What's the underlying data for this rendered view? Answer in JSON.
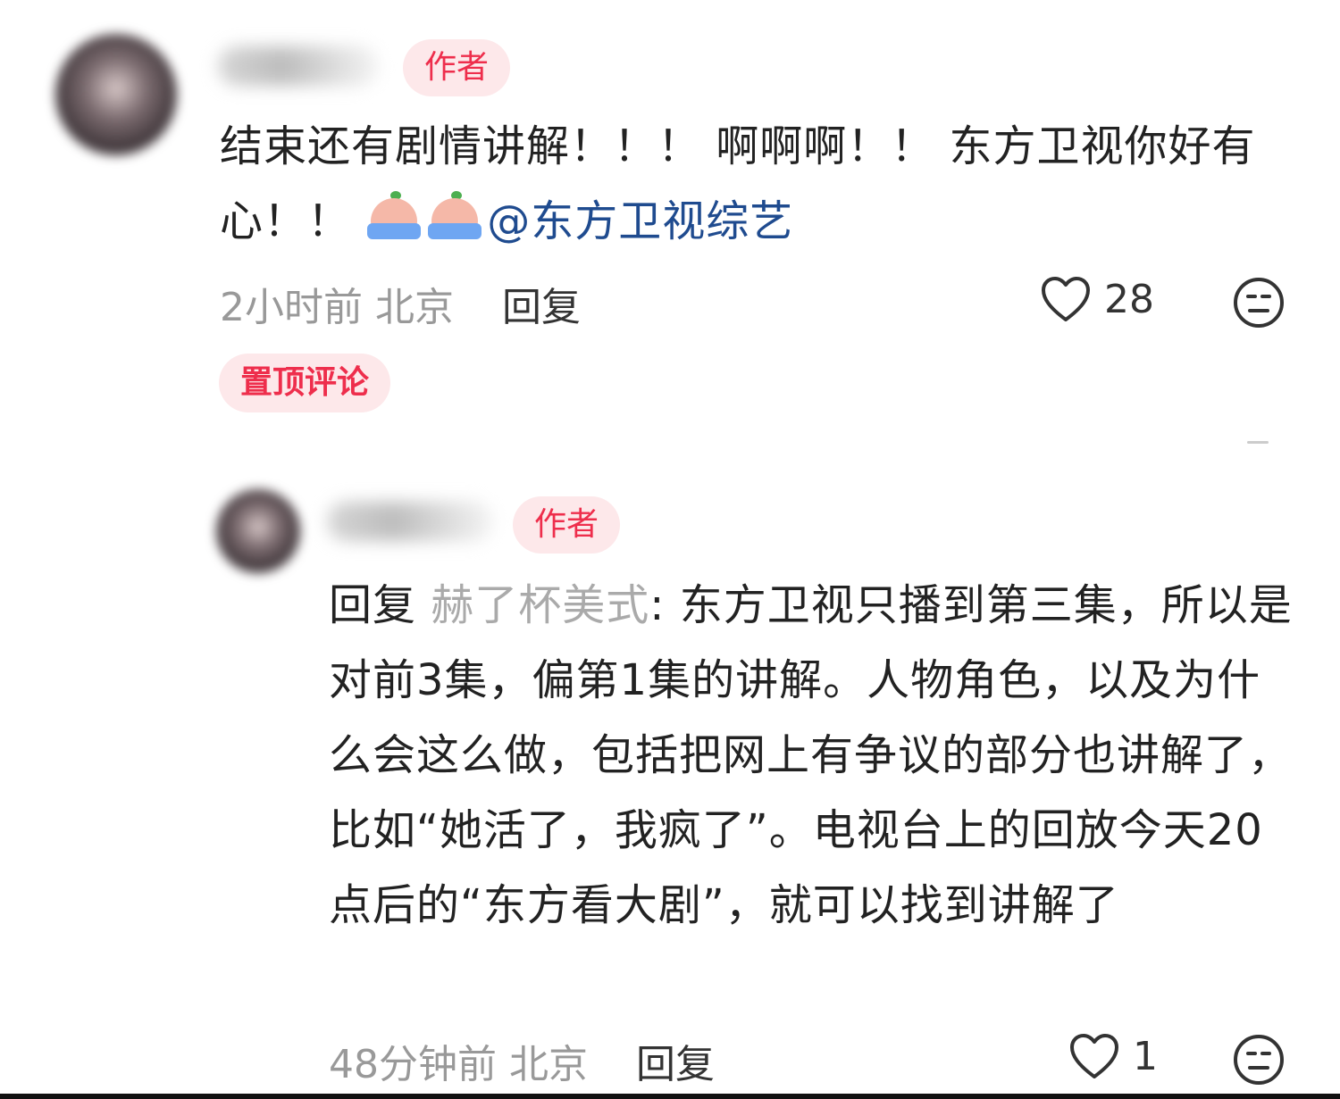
{
  "pinned_comment": {
    "author_badge": "作者",
    "text_before_emoji": "结束还有剧情讲解！！！ 啊啊啊！！ 东方卫视你好有心！！",
    "emojis": [
      "crying-face-emoji",
      "crying-face-emoji"
    ],
    "mention": "@东方卫视综艺",
    "time": "2小时前",
    "location": "北京",
    "reply_label": "回复",
    "like_count": "28",
    "pin_label": "置顶评论"
  },
  "reply_comment": {
    "author_badge": "作者",
    "reply_prefix": "回复",
    "reply_target": "赫了杯美式",
    "text": ": 东方卫视只播到第三集，所以是对前3集，偏第1集的讲解。人物角色，以及为什么会这么做，包括把网上有争议的部分也讲解了，比如“她活了，我疯了”。电视台上的回放今天20点后的“东方看大剧”，就可以找到讲解了",
    "time": "48分钟前",
    "location": "北京",
    "reply_label": "回复",
    "like_count": "1"
  },
  "colors": {
    "accent": "#ee2e4c",
    "badge_bg": "#fde8ea",
    "mention": "#1f4b8f",
    "meta": "#999999"
  }
}
